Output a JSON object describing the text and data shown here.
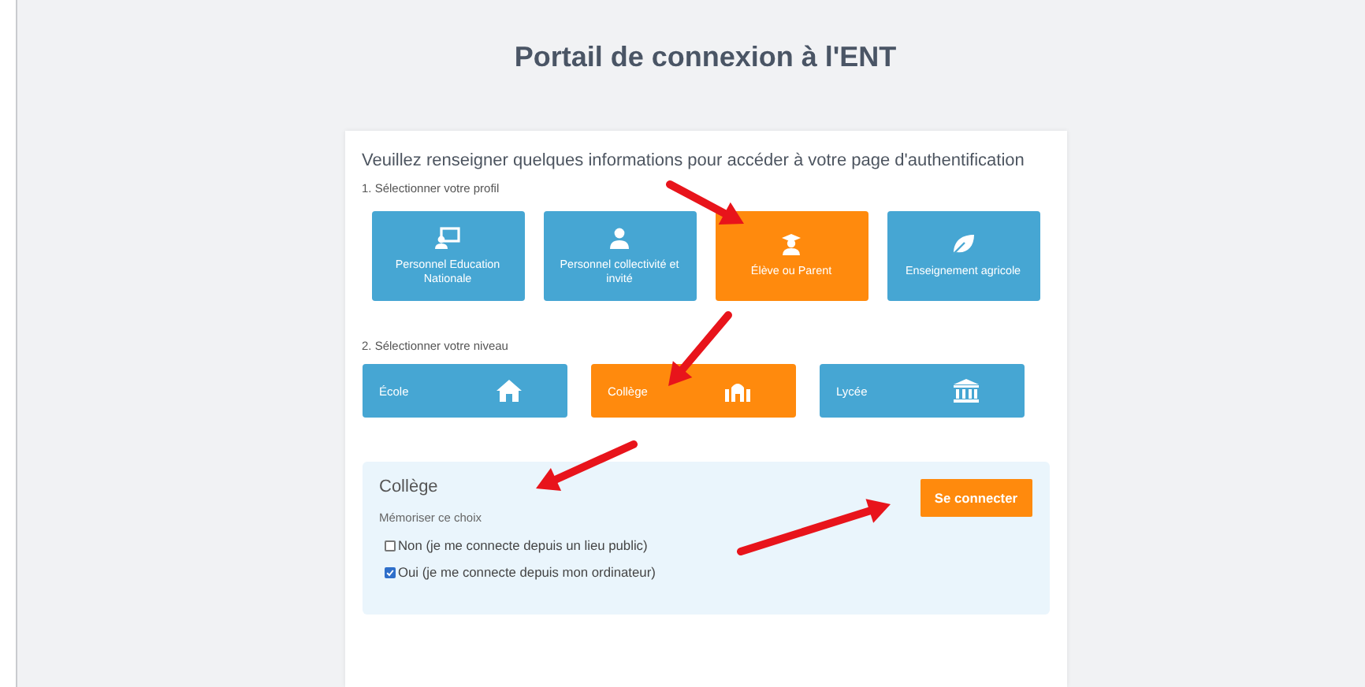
{
  "title": "Portail de connexion à l'ENT",
  "intro": "Veuillez renseigner quelques informations pour accéder à votre page d'authentification",
  "profile_step": "1. Sélectionner votre profil",
  "profiles": [
    {
      "label": "Personnel Education Nationale",
      "selected": false
    },
    {
      "label": "Personnel collectivité et invité",
      "selected": false
    },
    {
      "label": "Élève ou Parent",
      "selected": true
    },
    {
      "label": "Enseignement agricole",
      "selected": false
    }
  ],
  "level_step": "2. Sélectionner votre niveau",
  "levels": [
    {
      "label": "École",
      "selected": false
    },
    {
      "label": "Collège",
      "selected": true
    },
    {
      "label": "Lycée",
      "selected": false
    }
  ],
  "panel": {
    "title": "Collège",
    "remember_label": "Mémoriser ce choix",
    "options": [
      {
        "label": "Non (je me connecte depuis un lieu public)",
        "checked": false
      },
      {
        "label": "Oui (je me connecte depuis mon ordinateur)",
        "checked": true
      }
    ],
    "button": "Se connecter"
  }
}
